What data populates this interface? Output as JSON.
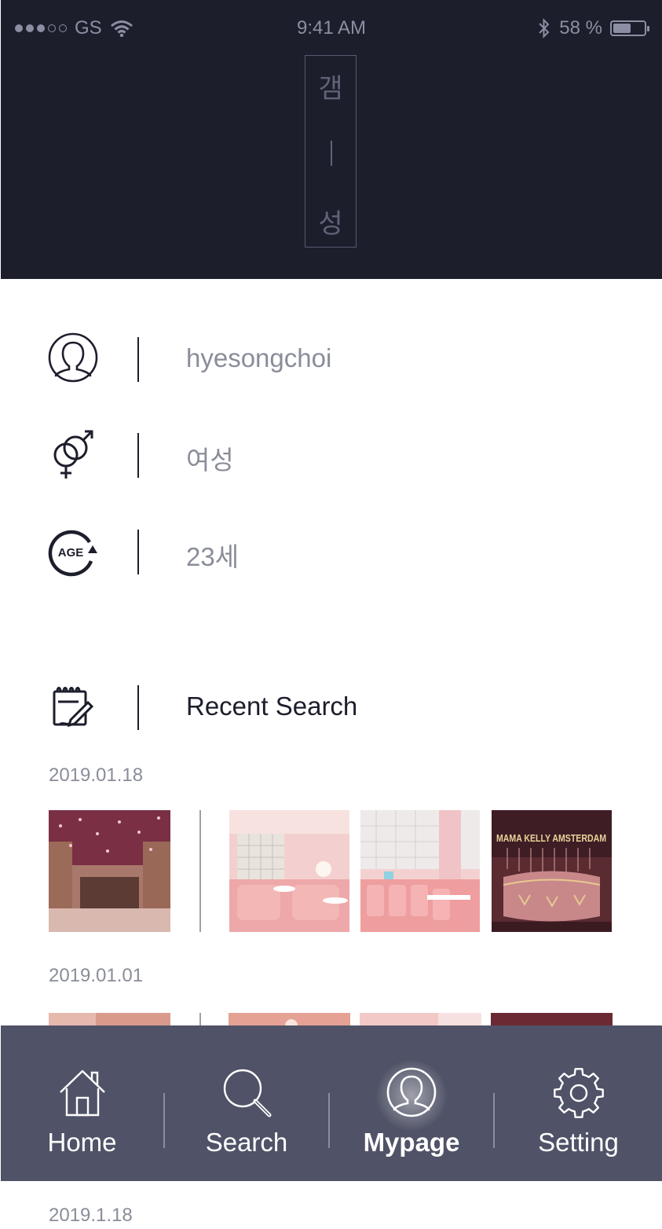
{
  "status_bar": {
    "carrier": "GS",
    "time": "9:41 AM",
    "battery": "58 %",
    "battery_level": 0.58
  },
  "header": {
    "logo_top": "갬",
    "logo_bottom": "성"
  },
  "profile": {
    "username": "hyesongchoi",
    "gender": "여성",
    "age": "23세",
    "age_icon_text": "AGE"
  },
  "recent": {
    "title": "Recent Search",
    "groups": [
      {
        "date": "2019.01.18"
      },
      {
        "date": "2019.01.01"
      },
      {
        "date": "2019.1.18"
      }
    ],
    "sign_text": "MAMA KELLY AMSTERDAM"
  },
  "nav": {
    "items": [
      {
        "label": "Home",
        "icon": "home-icon"
      },
      {
        "label": "Search",
        "icon": "search-icon"
      },
      {
        "label": "Mypage",
        "icon": "user-icon",
        "active": true
      },
      {
        "label": "Setting",
        "icon": "gear-icon"
      }
    ]
  },
  "colors": {
    "header_bg": "#1d1e2c",
    "nav_bg": "#505367",
    "muted_text": "#8a8d99",
    "accent_pink": "#e9a3a6"
  }
}
